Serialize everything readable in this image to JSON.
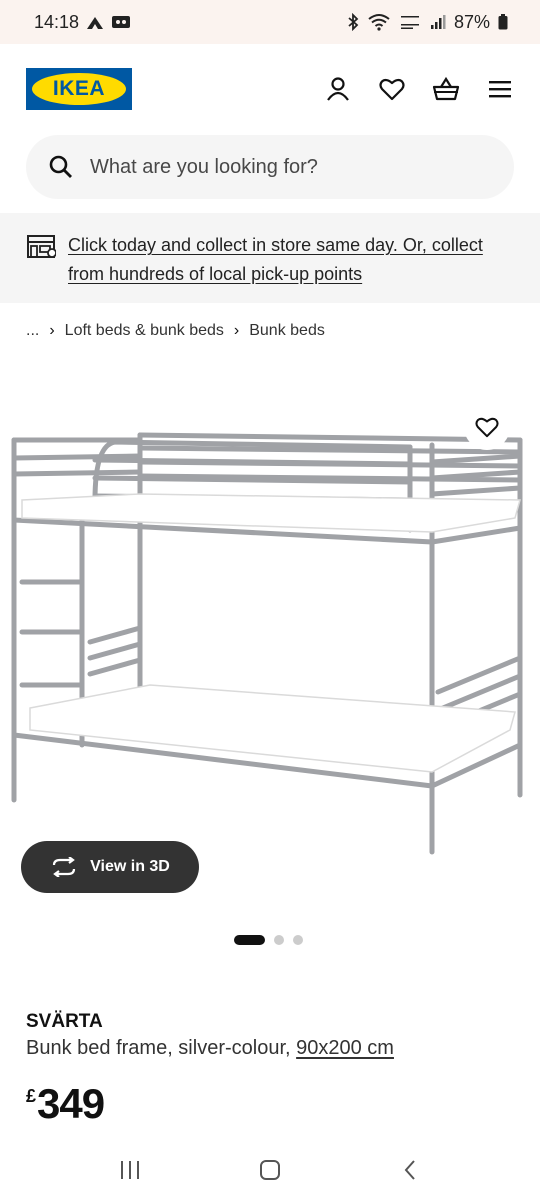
{
  "status_bar": {
    "time": "14:18",
    "battery": "87%"
  },
  "header": {
    "logo_text": "IKEA",
    "icons": [
      "account-icon",
      "heart-icon",
      "basket-icon",
      "menu-icon"
    ]
  },
  "search": {
    "placeholder": "What are you looking for?"
  },
  "banner": {
    "text": "Click today and collect in store same day. Or, collect from hundreds of local pick-up points"
  },
  "breadcrumb": {
    "ellipsis": "...",
    "items": [
      "Loft beds & bunk beds",
      "Bunk beds"
    ]
  },
  "product": {
    "view3d_label": "View in 3D",
    "carousel": {
      "count": 3,
      "active": 0
    },
    "name": "SVÄRTA",
    "description": "Bunk bed frame, silver-colour, ",
    "size": "90x200 cm",
    "price_currency": "£",
    "price_value": "349"
  },
  "colors": {
    "ikea_blue": "#0058a3",
    "ikea_yellow": "#ffdb00",
    "banner_bg": "#f5f5f5",
    "dark_button": "#333333"
  }
}
